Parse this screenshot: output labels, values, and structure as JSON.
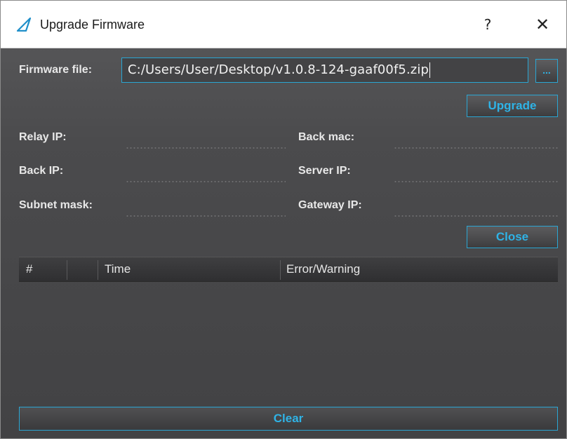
{
  "window": {
    "title": "Upgrade Firmware",
    "help_label": "?",
    "close_label": "✕"
  },
  "firmware": {
    "label": "Firmware file:",
    "path": "C:/Users/User/Desktop/v1.0.8-124-gaaf00f5.zip",
    "browse_label": "..."
  },
  "buttons": {
    "upgrade": "Upgrade",
    "close": "Close",
    "clear": "Clear"
  },
  "fields": {
    "relay_ip": "Relay IP:",
    "back_mac": "Back mac:",
    "back_ip": "Back IP:",
    "server_ip": "Server IP:",
    "subnet_mask": "Subnet mask:",
    "gateway_ip": "Gateway IP:"
  },
  "table": {
    "columns": [
      "#",
      "",
      "Time",
      "Error/Warning"
    ]
  },
  "colors": {
    "accent": "#2aa6d3",
    "background": "#4a4a4c",
    "titlebar": "#ffffff"
  },
  "icons": {
    "app": "sail-triangle-icon"
  }
}
